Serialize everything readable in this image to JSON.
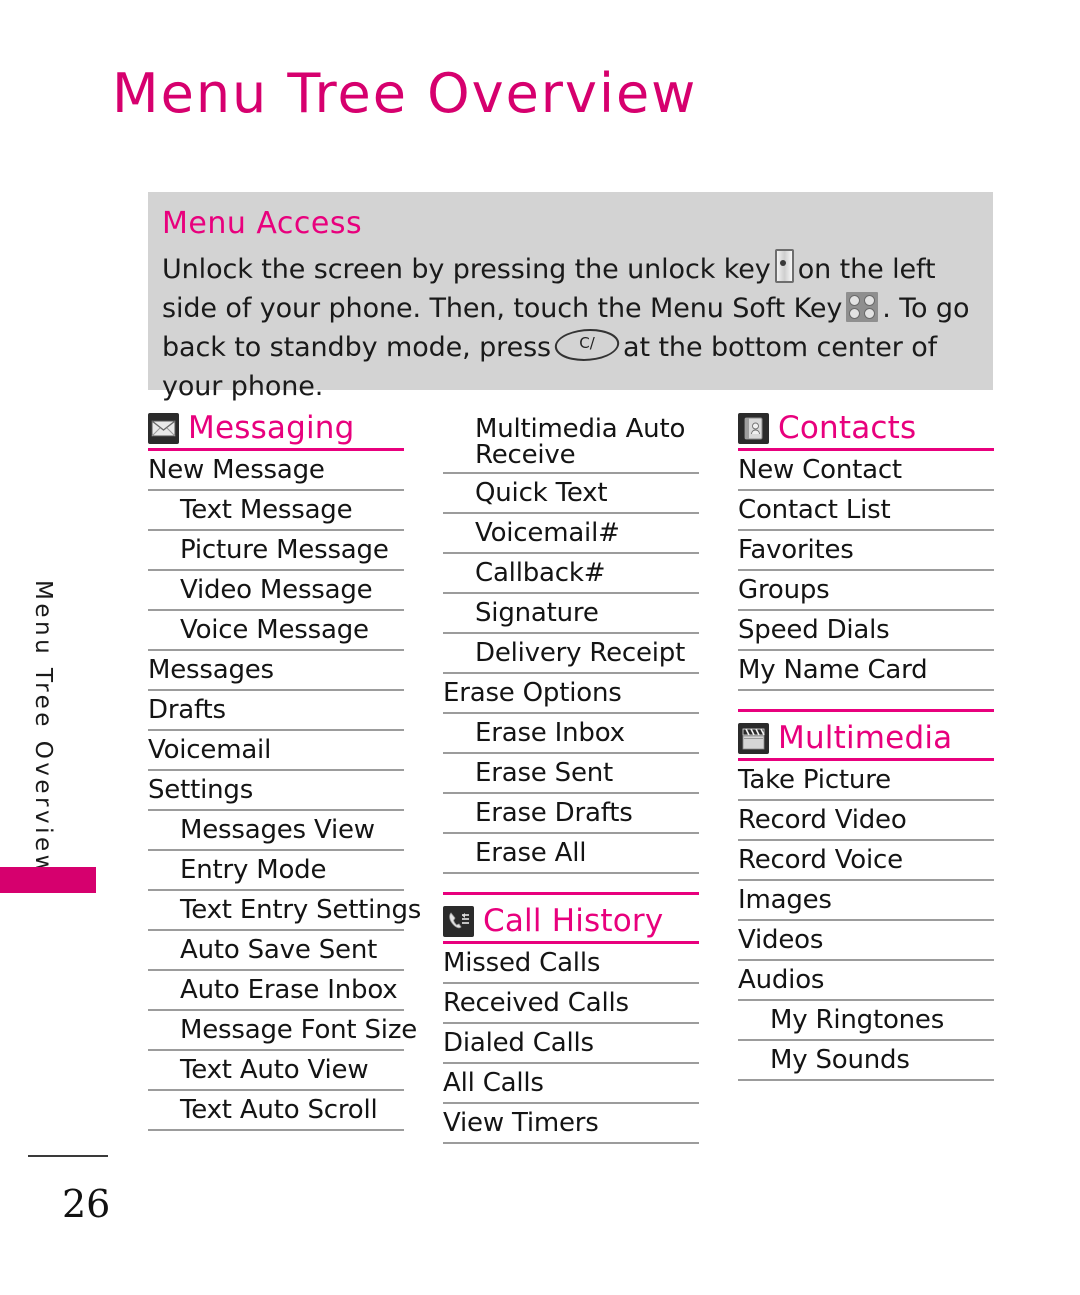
{
  "page": {
    "title": "Menu Tree Overview",
    "side_tab_label": "Menu Tree Overview",
    "page_number": "26",
    "accent_color": "#e8007d",
    "title_color": "#d6006e",
    "panel_bg": "#d3d3d3",
    "rule_color": "#9c9c9c"
  },
  "menu_access": {
    "title": "Menu Access",
    "line1_a": "Unlock the screen by pressing the unlock key",
    "icon_unlock": "unlock-key-icon",
    "line1_b": "on the left side of",
    "line2_a": "your phone. Then, touch the Menu Soft Key",
    "icon_softkey": "menu-soft-key-icon",
    "line2_b": ". To go back to",
    "line3_a": "standby mode, press",
    "icon_end": "clear-end-key-icon",
    "icon_end_label": "C/",
    "line3_b": "at the bottom center of your phone."
  },
  "sections": {
    "messaging": {
      "title": "Messaging",
      "icon": "envelope-icon",
      "items": [
        {
          "label": "New Message",
          "level": 1
        },
        {
          "label": "Text Message",
          "level": 2
        },
        {
          "label": "Picture Message",
          "level": 2
        },
        {
          "label": "Video Message",
          "level": 2
        },
        {
          "label": "Voice Message",
          "level": 2
        },
        {
          "label": "Messages",
          "level": 1
        },
        {
          "label": "Drafts",
          "level": 1
        },
        {
          "label": "Voicemail",
          "level": 1
        },
        {
          "label": "Settings",
          "level": 1
        },
        {
          "label": "Messages View",
          "level": 2
        },
        {
          "label": "Entry Mode",
          "level": 2
        },
        {
          "label": "Text Entry Settings",
          "level": 2
        },
        {
          "label": "Auto Save Sent",
          "level": 2
        },
        {
          "label": "Auto Erase Inbox",
          "level": 2
        },
        {
          "label": "Message Font Size",
          "level": 2
        },
        {
          "label": "Text Auto View",
          "level": 2
        },
        {
          "label": "Text Auto Scroll",
          "level": 2
        }
      ]
    },
    "messaging_continued": {
      "items": [
        {
          "label": "Multimedia Auto Receive",
          "level": 2,
          "wrap": true
        },
        {
          "label": "Quick Text",
          "level": 2
        },
        {
          "label": "Voicemail#",
          "level": 2
        },
        {
          "label": "Callback#",
          "level": 2
        },
        {
          "label": "Signature",
          "level": 2
        },
        {
          "label": "Delivery Receipt",
          "level": 2
        },
        {
          "label": "Erase Options",
          "level": 1
        },
        {
          "label": "Erase Inbox",
          "level": 2
        },
        {
          "label": "Erase Sent",
          "level": 2
        },
        {
          "label": "Erase Drafts",
          "level": 2
        },
        {
          "label": "Erase All",
          "level": 2
        }
      ]
    },
    "call_history": {
      "title": "Call History",
      "icon": "phone-history-icon",
      "items": [
        {
          "label": "Missed Calls",
          "level": 1
        },
        {
          "label": "Received Calls",
          "level": 1
        },
        {
          "label": "Dialed Calls",
          "level": 1
        },
        {
          "label": "All Calls",
          "level": 1
        },
        {
          "label": "View Timers",
          "level": 1
        }
      ]
    },
    "contacts": {
      "title": "Contacts",
      "icon": "contact-book-icon",
      "items": [
        {
          "label": "New Contact",
          "level": 1
        },
        {
          "label": "Contact List",
          "level": 1
        },
        {
          "label": "Favorites",
          "level": 1
        },
        {
          "label": "Groups",
          "level": 1
        },
        {
          "label": "Speed Dials",
          "level": 1
        },
        {
          "label": "My Name Card",
          "level": 1
        }
      ]
    },
    "multimedia": {
      "title": "Multimedia",
      "icon": "clapperboard-icon",
      "items": [
        {
          "label": "Take Picture",
          "level": 1
        },
        {
          "label": "Record Video",
          "level": 1
        },
        {
          "label": "Record Voice",
          "level": 1
        },
        {
          "label": "Images",
          "level": 1
        },
        {
          "label": "Videos",
          "level": 1
        },
        {
          "label": "Audios",
          "level": 1
        },
        {
          "label": "My Ringtones",
          "level": 2
        },
        {
          "label": "My Sounds",
          "level": 2
        }
      ]
    }
  }
}
